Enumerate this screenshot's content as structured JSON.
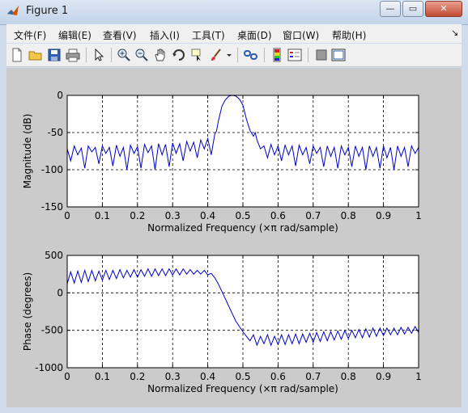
{
  "window": {
    "title": "Figure 1",
    "minimize_label": "—",
    "restore_label": "▭",
    "close_label": "✕"
  },
  "menu": {
    "items": [
      {
        "label": "文件(F)"
      },
      {
        "label": "编辑(E)"
      },
      {
        "label": "查看(V)"
      },
      {
        "label": "插入(I)"
      },
      {
        "label": "工具(T)"
      },
      {
        "label": "桌面(D)"
      },
      {
        "label": "窗口(W)"
      },
      {
        "label": "帮助(H)"
      }
    ],
    "dock_arrow": "↘"
  },
  "toolbar": {
    "icons": [
      "new-figure-icon",
      "open-file-icon",
      "save-icon",
      "print-icon",
      "select-arrow-icon",
      "zoom-in-icon",
      "zoom-out-icon",
      "pan-hand-icon",
      "rotate-3d-icon",
      "data-cursor-icon",
      "brush-icon",
      "link-plot-icon",
      "colorbar-icon",
      "legend-icon",
      "hide-plot-tools-icon",
      "show-plot-tools-icon"
    ]
  },
  "chart_data": [
    {
      "type": "line",
      "xlabel": "Normalized Frequency  (×π rad/sample)",
      "ylabel": "Magnitude (dB)",
      "xlim": [
        0,
        1
      ],
      "ylim": [
        -150,
        0
      ],
      "xticks": [
        "0",
        "0.1",
        "0.2",
        "0.3",
        "0.4",
        "0.5",
        "0.6",
        "0.7",
        "0.8",
        "0.9",
        "1"
      ],
      "yticks": [
        "0",
        "-50",
        "-100",
        "-150"
      ],
      "grid": true,
      "color": "#0000c8",
      "series": [
        {
          "x": [
            0,
            0.01,
            0.02,
            0.03,
            0.04,
            0.05,
            0.06,
            0.07,
            0.08,
            0.09,
            0.1,
            0.11,
            0.12,
            0.13,
            0.14,
            0.15,
            0.16,
            0.17,
            0.18,
            0.19,
            0.2,
            0.21,
            0.22,
            0.23,
            0.24,
            0.25,
            0.26,
            0.27,
            0.28,
            0.29,
            0.3,
            0.31,
            0.32,
            0.33,
            0.34,
            0.35,
            0.36,
            0.37,
            0.38,
            0.39,
            0.4,
            0.41,
            0.42,
            0.425,
            0.43,
            0.44,
            0.45,
            0.46,
            0.47,
            0.48,
            0.49,
            0.5,
            0.51,
            0.52,
            0.53,
            0.535,
            0.54,
            0.55,
            0.56,
            0.57,
            0.58,
            0.59,
            0.6,
            0.61,
            0.62,
            0.63,
            0.64,
            0.65,
            0.66,
            0.67,
            0.68,
            0.69,
            0.7,
            0.71,
            0.72,
            0.73,
            0.74,
            0.75,
            0.76,
            0.77,
            0.78,
            0.79,
            0.8,
            0.81,
            0.82,
            0.83,
            0.84,
            0.85,
            0.86,
            0.87,
            0.88,
            0.89,
            0.9,
            0.91,
            0.92,
            0.93,
            0.94,
            0.95,
            0.96,
            0.97,
            0.98,
            0.99,
            1
          ],
          "y": [
            -72,
            -88,
            -68,
            -80,
            -71,
            -98,
            -68,
            -76,
            -70,
            -92,
            -68,
            -78,
            -70,
            -95,
            -67,
            -82,
            -70,
            -100,
            -67,
            -78,
            -69,
            -98,
            -66,
            -77,
            -68,
            -100,
            -65,
            -80,
            -66,
            -96,
            -64,
            -78,
            -65,
            -88,
            -62,
            -75,
            -63,
            -84,
            -60,
            -72,
            -58,
            -80,
            -52,
            -48,
            -35,
            -15,
            -6,
            -1,
            0,
            -1,
            -5,
            -13,
            -32,
            -47,
            -55,
            -50,
            -60,
            -72,
            -68,
            -84,
            -66,
            -80,
            -68,
            -88,
            -67,
            -80,
            -68,
            -95,
            -67,
            -80,
            -70,
            -92,
            -68,
            -78,
            -70,
            -96,
            -68,
            -82,
            -70,
            -98,
            -68,
            -80,
            -70,
            -96,
            -68,
            -82,
            -70,
            -100,
            -68,
            -82,
            -70,
            -98,
            -68,
            -84,
            -70,
            -100,
            -68,
            -82,
            -70,
            -96,
            -68,
            -78,
            -70
          ]
        }
      ]
    },
    {
      "type": "line",
      "xlabel": "Normalized Frequency  (×π rad/sample)",
      "ylabel": "Phase (degrees)",
      "xlim": [
        0,
        1
      ],
      "ylim": [
        -1000,
        500
      ],
      "xticks": [
        "0",
        "0.1",
        "0.2",
        "0.3",
        "0.4",
        "0.5",
        "0.6",
        "0.7",
        "0.8",
        "0.9",
        "1"
      ],
      "yticks": [
        "500",
        "0",
        "-500",
        "-1000"
      ],
      "grid": true,
      "color": "#0000c8",
      "series": [
        {
          "x": [
            0,
            0.01,
            0.02,
            0.03,
            0.04,
            0.05,
            0.06,
            0.07,
            0.08,
            0.09,
            0.1,
            0.11,
            0.12,
            0.13,
            0.14,
            0.15,
            0.16,
            0.17,
            0.18,
            0.19,
            0.2,
            0.21,
            0.22,
            0.23,
            0.24,
            0.25,
            0.26,
            0.27,
            0.28,
            0.29,
            0.3,
            0.31,
            0.32,
            0.33,
            0.34,
            0.35,
            0.36,
            0.37,
            0.38,
            0.39,
            0.4,
            0.41,
            0.42,
            0.43,
            0.44,
            0.45,
            0.46,
            0.47,
            0.48,
            0.49,
            0.5,
            0.51,
            0.52,
            0.53,
            0.54,
            0.55,
            0.56,
            0.57,
            0.58,
            0.59,
            0.6,
            0.61,
            0.62,
            0.63,
            0.64,
            0.65,
            0.66,
            0.67,
            0.68,
            0.69,
            0.7,
            0.71,
            0.72,
            0.73,
            0.74,
            0.75,
            0.76,
            0.77,
            0.78,
            0.79,
            0.8,
            0.81,
            0.82,
            0.83,
            0.84,
            0.85,
            0.86,
            0.87,
            0.88,
            0.89,
            0.9,
            0.91,
            0.92,
            0.93,
            0.94,
            0.95,
            0.96,
            0.97,
            0.98,
            0.99,
            1
          ],
          "y": [
            120,
            280,
            130,
            290,
            140,
            300,
            150,
            300,
            160,
            290,
            170,
            300,
            180,
            300,
            190,
            310,
            200,
            300,
            210,
            310,
            210,
            310,
            220,
            320,
            220,
            320,
            230,
            320,
            230,
            320,
            240,
            320,
            240,
            320,
            250,
            310,
            250,
            300,
            250,
            300,
            240,
            260,
            200,
            120,
            20,
            -80,
            -180,
            -280,
            -380,
            -450,
            -520,
            -580,
            -640,
            -560,
            -700,
            -580,
            -680,
            -560,
            -700,
            -580,
            -690,
            -560,
            -690,
            -560,
            -680,
            -550,
            -680,
            -550,
            -660,
            -540,
            -660,
            -530,
            -650,
            -520,
            -640,
            -520,
            -630,
            -510,
            -620,
            -500,
            -610,
            -500,
            -600,
            -490,
            -600,
            -480,
            -590,
            -470,
            -580,
            -470,
            -570,
            -470,
            -560,
            -470,
            -560,
            -460,
            -550,
            -460,
            -540,
            -450,
            -530
          ]
        }
      ]
    }
  ]
}
